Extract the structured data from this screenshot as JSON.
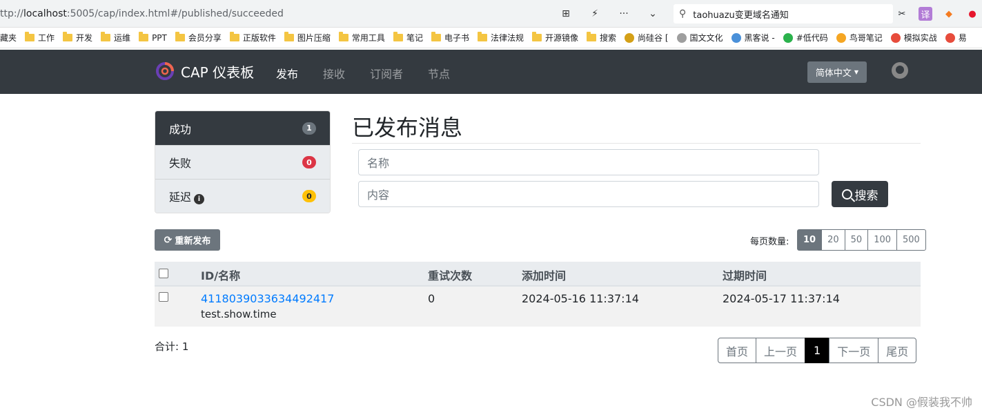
{
  "browser": {
    "url_prefix": "ttp://",
    "url_host": "localhost",
    "url_rest": ":5005/cap/index.html#/published/succeeded",
    "search_text": "taohuazu变更域名通知",
    "bookmarks": [
      {
        "label": "藏夹",
        "type": "text"
      },
      {
        "label": "工作",
        "type": "folder"
      },
      {
        "label": "开发",
        "type": "folder"
      },
      {
        "label": "运维",
        "type": "folder"
      },
      {
        "label": "PPT",
        "type": "folder"
      },
      {
        "label": "会员分享",
        "type": "folder"
      },
      {
        "label": "正版软件",
        "type": "folder"
      },
      {
        "label": "图片压缩",
        "type": "folder"
      },
      {
        "label": "常用工具",
        "type": "folder"
      },
      {
        "label": "笔记",
        "type": "folder"
      },
      {
        "label": "电子书",
        "type": "folder"
      },
      {
        "label": "法律法规",
        "type": "folder"
      },
      {
        "label": "开源镜像",
        "type": "folder"
      },
      {
        "label": "搜索",
        "type": "folder"
      },
      {
        "label": "尚硅谷 [",
        "type": "round",
        "color": "#d4a017"
      },
      {
        "label": "国文文化",
        "type": "round",
        "color": "#9e9e9e"
      },
      {
        "label": "黑客说 -",
        "type": "round",
        "color": "#4a90d9"
      },
      {
        "label": "#低代码",
        "type": "round",
        "color": "#2bb24c"
      },
      {
        "label": "鸟哥笔记",
        "type": "round",
        "color": "#f5a623"
      },
      {
        "label": "模拟实战",
        "type": "round",
        "color": "#e74c3c"
      },
      {
        "label": "易",
        "type": "round",
        "color": "#e74c3c"
      }
    ]
  },
  "nav": {
    "brand": "CAP 仪表板",
    "links": [
      "发布",
      "接收",
      "订阅者",
      "节点"
    ],
    "language": "简体中文"
  },
  "sidebar": [
    {
      "label": "成功",
      "count": "1",
      "badge": "gray"
    },
    {
      "label": "失败",
      "count": "0",
      "badge": "red"
    },
    {
      "label": "延迟",
      "count": "0",
      "badge": "yellow",
      "info": "i"
    }
  ],
  "main": {
    "title": "已发布消息",
    "name_placeholder": "名称",
    "content_placeholder": "内容",
    "search_label": "搜索",
    "republish_label": "重新发布",
    "page_size_label": "每页数量:",
    "page_sizes": [
      "10",
      "20",
      "50",
      "100",
      "500"
    ],
    "table": {
      "headers": [
        "ID/名称",
        "重试次数",
        "添加时间",
        "过期时间"
      ],
      "rows": [
        {
          "id": "4118039033634492417",
          "name": "test.show.time",
          "retries": "0",
          "added": "2024-05-16 11:37:14",
          "expires": "2024-05-17 11:37:14"
        }
      ]
    },
    "total": "合计: 1",
    "pager": [
      "首页",
      "上一页",
      "1",
      "下一页",
      "尾页"
    ]
  },
  "watermark": "CSDN @假装我不帅"
}
